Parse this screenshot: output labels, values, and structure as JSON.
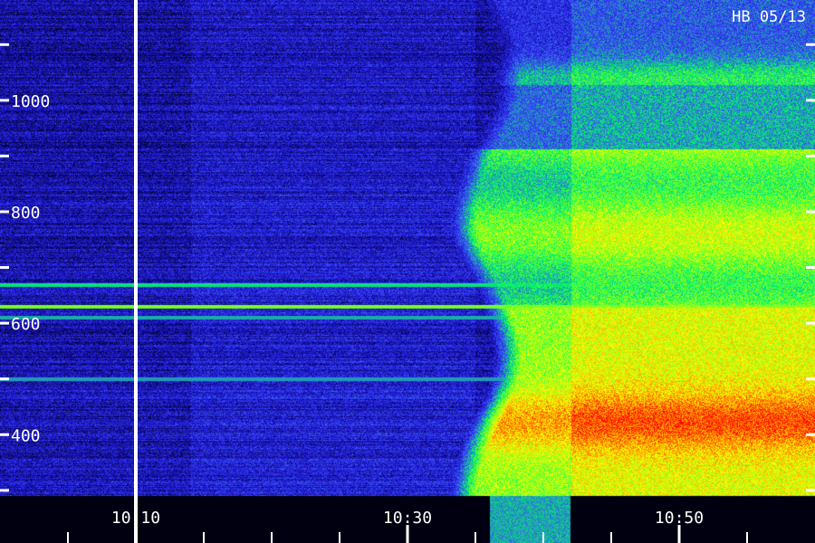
{
  "chart_data": {
    "type": "heatmap",
    "title": "",
    "corner_label": "HB 05/13",
    "xlabel": "",
    "ylabel": "",
    "x_ticks": [
      {
        "time": "10:10",
        "label": "10:10"
      },
      {
        "time": "10:30",
        "label": "10:30"
      },
      {
        "time": "10:50",
        "label": "10:50"
      }
    ],
    "x_minor_tick_interval_minutes": 5,
    "y_ticks": [
      {
        "value": 1000,
        "label": "1000"
      },
      {
        "value": 800,
        "label": "800"
      },
      {
        "value": 600,
        "label": "600"
      },
      {
        "value": 400,
        "label": "400"
      }
    ],
    "y_minor_ticks": [
      1100,
      900,
      700,
      500,
      300
    ],
    "xlim": [
      "10:00",
      "11:00"
    ],
    "ylim": [
      290,
      1180
    ],
    "marker_time": "10:10",
    "colormap": [
      "#000010",
      "#1a14c8",
      "#3c46ff",
      "#00ff60",
      "#80ff20",
      "#ffff00",
      "#ff8000",
      "#ff0000"
    ],
    "features": {
      "onset_time": "10:35",
      "step_time": "10:42",
      "band_lines": [
        {
          "value": 630,
          "intensity": 0.55
        },
        {
          "value": 670,
          "intensity": 0.35
        },
        {
          "value": 610,
          "intensity": 0.25
        },
        {
          "value": 500,
          "intensity": 0.22
        }
      ]
    },
    "grid": false
  }
}
